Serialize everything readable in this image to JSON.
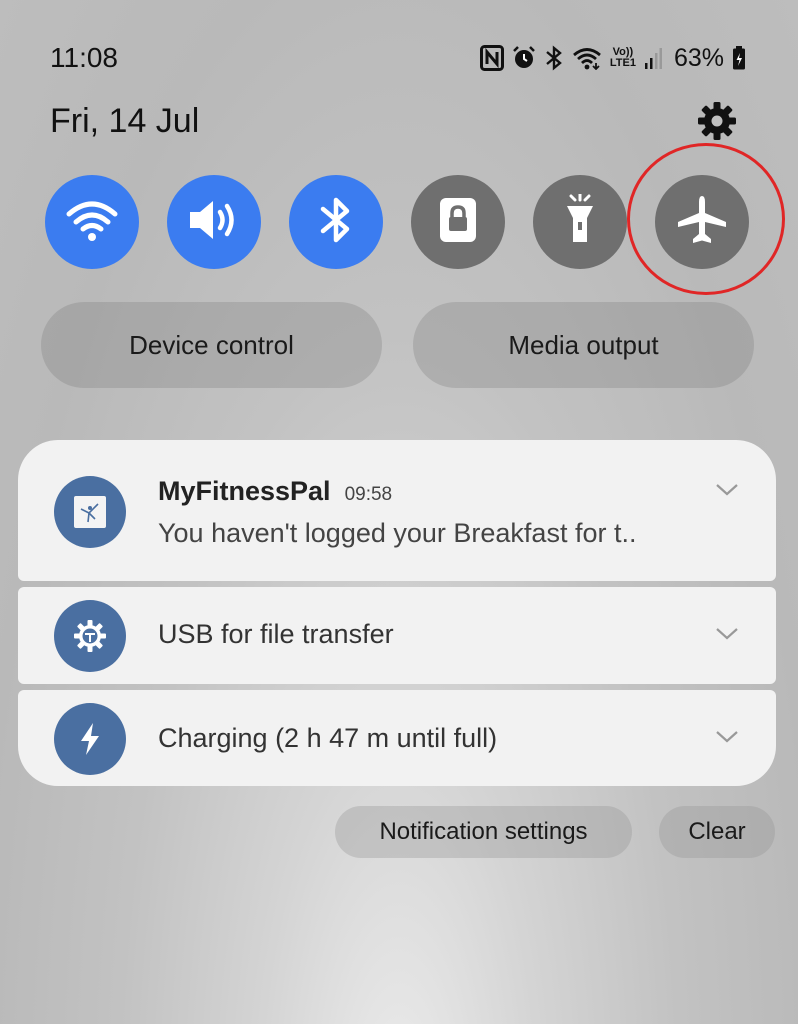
{
  "status_bar": {
    "time": "11:08",
    "battery_percent": "63%",
    "icons": [
      "nfc-icon",
      "alarm-icon",
      "bluetooth-icon",
      "wifi-icon",
      "volte-lte-icon",
      "signal-icon",
      "battery-icon"
    ],
    "volte_label": "Vo))",
    "lte_label": "LTE1"
  },
  "header": {
    "date": "Fri, 14 Jul"
  },
  "quick_settings": {
    "tiles": [
      {
        "name": "wifi",
        "icon": "wifi-icon",
        "state": "on"
      },
      {
        "name": "sound",
        "icon": "speaker-icon",
        "state": "on"
      },
      {
        "name": "bluetooth",
        "icon": "bluetooth-icon",
        "state": "on"
      },
      {
        "name": "screen-lock",
        "icon": "lock-icon",
        "state": "off"
      },
      {
        "name": "flashlight",
        "icon": "flashlight-icon",
        "state": "off"
      },
      {
        "name": "airplane-mode",
        "icon": "airplane-icon",
        "state": "off"
      }
    ],
    "highlight_color": "#e02626"
  },
  "panel_buttons": {
    "device_control": "Device control",
    "media_output": "Media output"
  },
  "notifications": [
    {
      "app": "MyFitnessPal",
      "time": "09:58",
      "text": "You haven't logged your Breakfast for t..",
      "icon": "myfitnesspal-icon"
    },
    {
      "text": "USB for file transfer",
      "icon": "usb-settings-icon"
    },
    {
      "text": "Charging (2 h 47 m until full)",
      "icon": "charging-bolt-icon"
    }
  ],
  "footer_actions": {
    "notification_settings": "Notification settings",
    "clear": "Clear"
  },
  "colors": {
    "tile_on": "#3b7cf0",
    "tile_off": "#6f6f6f",
    "notification_icon_bg": "#4a6fa1",
    "card_bg": "#f2f2f2"
  }
}
